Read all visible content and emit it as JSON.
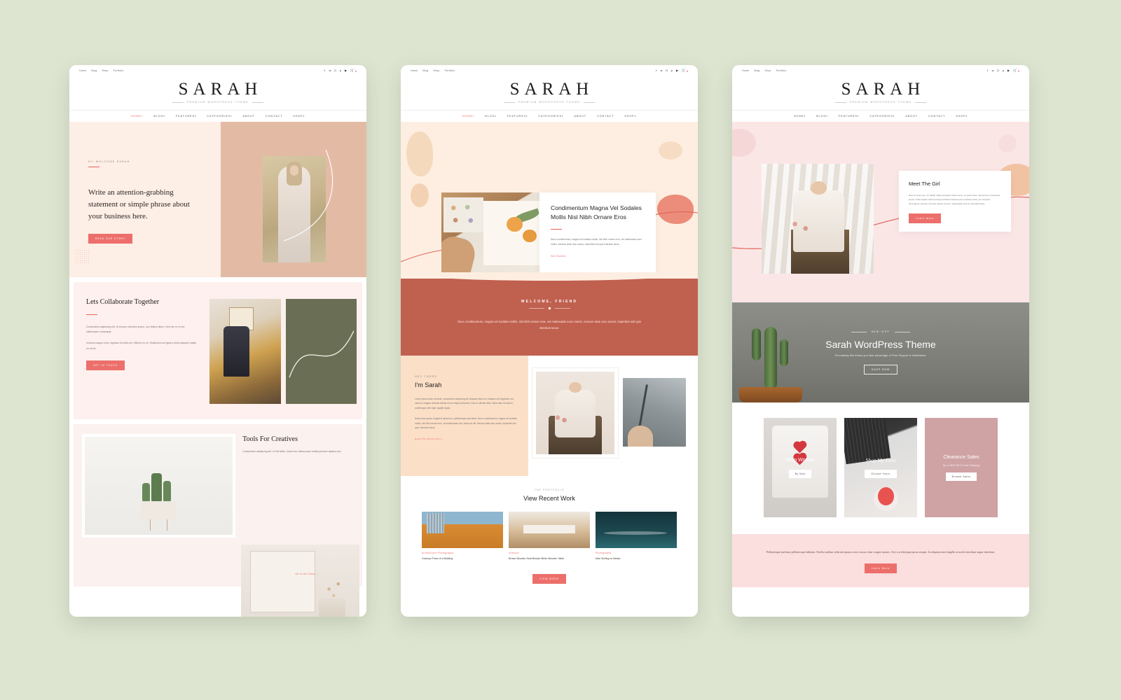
{
  "brand": {
    "name": "SARAH",
    "tagline": "PREMIUM WORDPRESS THEME"
  },
  "topbar": {
    "links": [
      "Home",
      "Blog",
      "Shop",
      "Portfolio"
    ],
    "social": [
      "facebook-icon",
      "twitter-icon",
      "instagram-icon",
      "pinterest-icon",
      "youtube-icon"
    ],
    "cart_count": "0"
  },
  "mainnav": [
    {
      "label": "HOME",
      "caret": "▾",
      "active": true
    },
    {
      "label": "BLOG",
      "caret": "▾",
      "active": false
    },
    {
      "label": "FEATURES",
      "caret": "▾",
      "active": false
    },
    {
      "label": "CATEGORIES",
      "caret": "▾",
      "active": false
    },
    {
      "label": "ABOUT",
      "caret": "",
      "active": false
    },
    {
      "label": "CONTACT",
      "caret": "",
      "active": false
    },
    {
      "label": "SHOP",
      "caret": "▾",
      "active": false
    }
  ],
  "panel1": {
    "hero": {
      "eyebrow": "HI! WELCOME SARAH",
      "headline": "Write an attention-grabbing statement or simple phrase about your business here.",
      "button": "READ OUR STORY"
    },
    "collaborate": {
      "heading": "Lets Collaborate Together",
      "paragraph1": "Consectetur adipiscing elit. Ut tempor interdum ipsum, non finibus libero. Sed nec ex et leo ullamcorper consequat.",
      "paragraph2": "Vivamus augue enim, egestas id mollis vel, efficitur eu mi. Vestibulum ac ligula a tellus aliquam mattis eu id est.",
      "button": "GET IN TOUCH"
    },
    "tools": {
      "heading": "Tools For Creatives",
      "paragraph": "Consectetur adipiscing elit. Ut elit tellus, luctus nec ullamcorper mattis pulvinar dapibus leo.",
      "shop_link": "Go to the Shop →"
    }
  },
  "panel2": {
    "hero_card": {
      "heading": "Condimentum Magna Vel Sodales Mollis Nisl Nibh Ornare Eros",
      "paragraph": "Nunc condimentum, magna vel sodales mollis, nisl nibh ornare eros, vel malesuada nunc metus. Aenean vitae arcu auctor, imperdiet nisl quis interdum lacus.",
      "link": "Get Started"
    },
    "welcome": {
      "heading": "WELCOME, FRIEND",
      "paragraph": "Nunc condimentum, magna vel sodales mollis, nisl nibh ornare eros, vel malesuada nunc metus. Aenean vitae arcu auctor, imperdiet nisl quis interdum lacus."
    },
    "about": {
      "eyebrow": "HEY THERE",
      "heading": "I'm Sarah",
      "paragraph1": "Lorem ipsum dolor sit amet, consectetur adipiscing elit. Aliquam libero ex, tristique sed dignissim vel, varius ut magna. Aenean lacinia mi orci aliquet pharetra. Duis ut ultricies felis. Nulla vitae mi dictum, scelerisque nibh eget, sagittis ligula.",
      "paragraph2": "Nulla tortor quam, feugiat id laoreet ac, pellentesque sed tellus. Nunc condimentum, magna vel sodales mollis, nisl nibh ornare eros, vel malesuada nunc metus at elit. Aenean vitae arcu auctor, imperdiet nisl quis, interdum lacus.",
      "link": "Read The Whole Story →"
    },
    "work": {
      "eyebrow": "THE PORTFOLIO",
      "heading": "View Recent Work",
      "items": [
        {
          "category": "Architecture Photography",
          "caption": "Closeup Photo of a Building"
        },
        {
          "category": "Interiors",
          "caption": "Brown Wooden Seat Beside White Wooden Table"
        },
        {
          "category": "Photography",
          "caption": "Man Surfing on Beach"
        }
      ],
      "button": "VIEW MORE"
    }
  },
  "panel3": {
    "card": {
      "heading": "Meet The Girl",
      "paragraph": "Nice to meet you, I'm Sarah. Etiam pharetra rutrum eros, eu porta risus. Aenean ac consectetur lectus. Class aptent taciti sociosqu ad litora torquent per conubia nostra, per inceptos himenaeos. Aenean sit amet mauris cursus, malesuada urna id, imperdiet justo.",
      "button": "Learn More"
    },
    "banner": {
      "badge": "50% OFF",
      "heading": "Sarah WordPress Theme",
      "subheading": "Purchasing this theme you take advantage of Free Support & Installation.",
      "button": "SHOP NOW"
    },
    "shop_cards": [
      {
        "title": "Shop Women",
        "sub": "",
        "button": "By Now",
        "style": "plain"
      },
      {
        "title": "Shop My Favs",
        "sub": "",
        "button": "Choose Yours",
        "style": "script"
      },
      {
        "title": "Clearance Sales",
        "sub": "Up to 60% Off & Free Shipping",
        "button": "Browse Sales",
        "style": "plain"
      }
    ],
    "footer": {
      "paragraph": "Pellentesque pulvinar pellentesque habitant. Facilisi nullam vehicula ipsum a arcu cursus vitae congue mauris. Orci a scelerisque purus semper. In aliquam sem fringilla ut morbi tincidunt augue interdum.",
      "button": "Learn More"
    }
  },
  "colors": {
    "page_bg": "#dde5d1",
    "accent": "#e8635f",
    "hero_cream": "#fdeee6",
    "hero_tan": "#e3bba5",
    "terracotta": "#c0604f",
    "peach": "#fbdfc7",
    "blush": "#fbe6e6",
    "olive": "#6a6e54",
    "mauve": "#cfa2a4"
  }
}
